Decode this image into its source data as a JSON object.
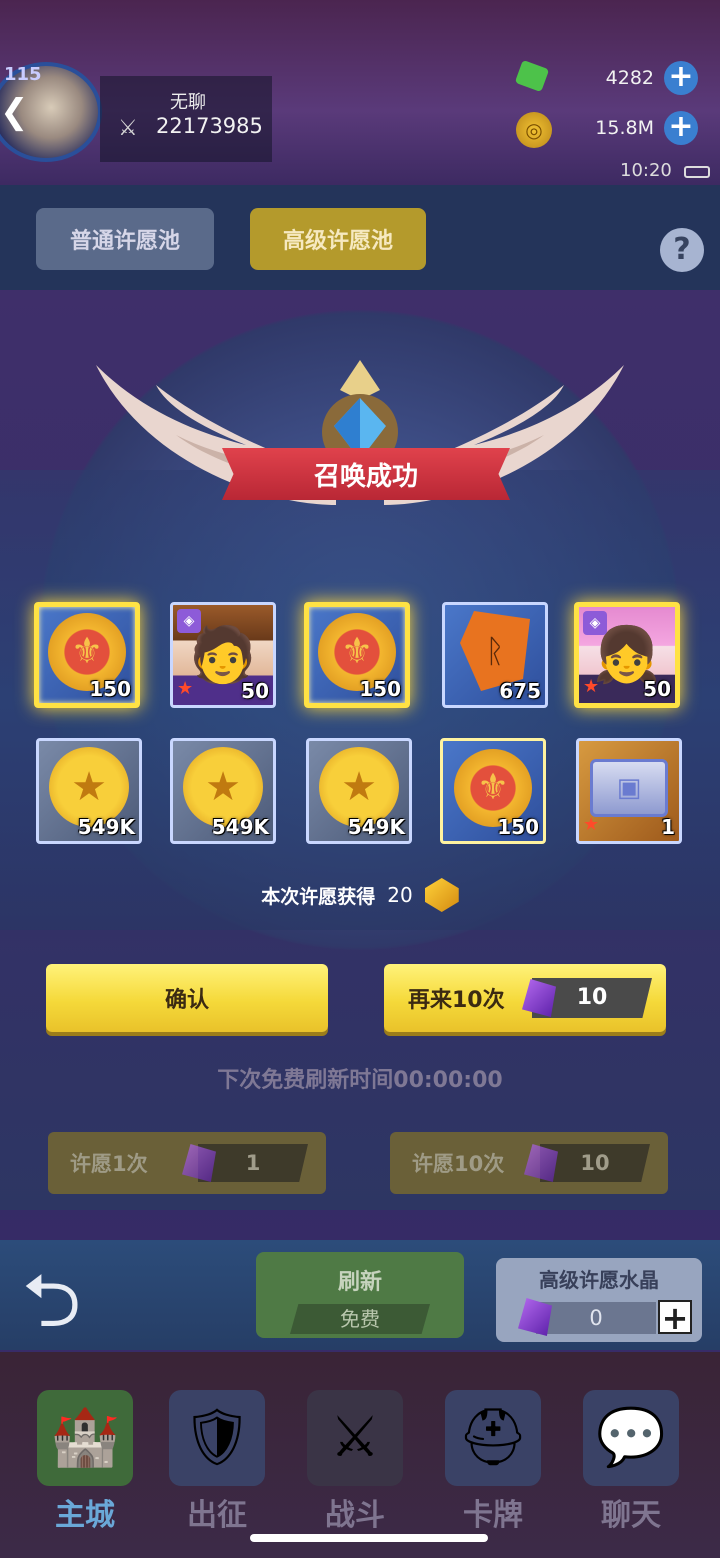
{
  "player": {
    "level": "115",
    "name": "无聊",
    "power": "22173985"
  },
  "resources": {
    "gems": "4282",
    "gold": "15.8M",
    "time": "10:20"
  },
  "tabs": [
    "普通许愿池",
    "高级许愿池"
  ],
  "help_label": "?",
  "banner_title": "召唤成功",
  "rewards": [
    {
      "type": "medal",
      "count": "150"
    },
    {
      "type": "hero",
      "count": "50"
    },
    {
      "type": "medal",
      "count": "150"
    },
    {
      "type": "rune",
      "count": "675"
    },
    {
      "type": "hero",
      "count": "50"
    },
    {
      "type": "coin",
      "count": "549K"
    },
    {
      "type": "coin",
      "count": "549K"
    },
    {
      "type": "coin",
      "count": "549K"
    },
    {
      "type": "medal",
      "count": "150"
    },
    {
      "type": "chest",
      "count": "1"
    }
  ],
  "earned": {
    "label": "本次许愿获得",
    "value": "20"
  },
  "buttons": {
    "confirm": "确认",
    "again": "再来10次",
    "again_cost": "10"
  },
  "free_refresh_text": "下次免费刷新时间00:00:00",
  "wish": {
    "once_label": "许愿1次",
    "once_cost": "1",
    "ten_label": "许愿10次",
    "ten_cost": "10"
  },
  "refresh": {
    "title": "刷新",
    "status": "免费"
  },
  "crystal": {
    "title": "高级许愿水晶",
    "count": "0",
    "plus": "+"
  },
  "nav": [
    "主城",
    "出征",
    "战斗",
    "卡牌",
    "聊天"
  ],
  "colors": {
    "accent_yellow": "#f5d93a",
    "banner_red": "#c92f3a",
    "nav_active": "#6aa8d8"
  }
}
